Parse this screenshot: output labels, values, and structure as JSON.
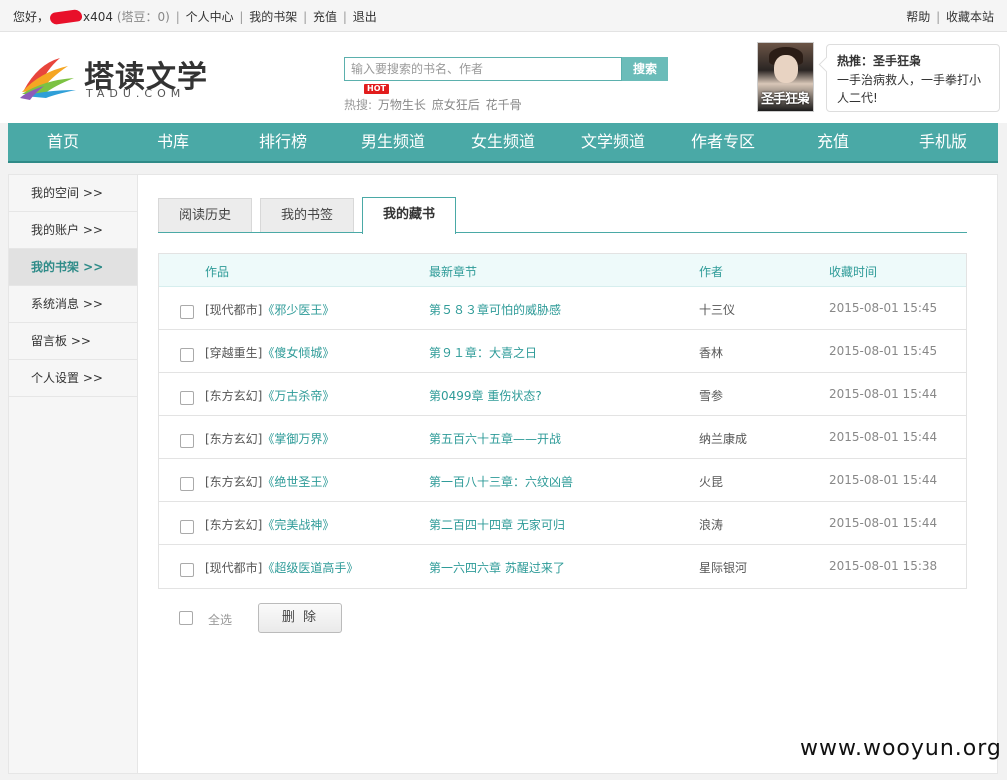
{
  "topbar": {
    "greeting_prefix": "您好，",
    "username_suffix": "x404",
    "beans": "(塔豆：0)",
    "sep": "|",
    "links": [
      "个人中心",
      "我的书架",
      "充值",
      "退出"
    ],
    "right_links": [
      "帮助",
      "收藏本站"
    ]
  },
  "header": {
    "logo_name": "塔读文学",
    "logo_sub": "TADU.COM",
    "search_placeholder": "输入要搜索的书名、作者",
    "search_button": "搜索",
    "hot_label": "热搜:",
    "hot_badge": "HOT",
    "hot_keywords": [
      "万物生长",
      "庶女狂后",
      "花千骨"
    ],
    "recommend": {
      "cover_title": "圣手狂枭",
      "title": "热推：圣手狂枭",
      "desc": "一手治病救人，一手拳打小人二代!"
    }
  },
  "nav": [
    "首页",
    "书库",
    "排行榜",
    "男生频道",
    "女生频道",
    "文学频道",
    "作者专区",
    "充值",
    "手机版"
  ],
  "sidebar": [
    {
      "label": "我的空间 >>",
      "active": false
    },
    {
      "label": "我的账户 >>",
      "active": false
    },
    {
      "label": "我的书架 >>",
      "active": true
    },
    {
      "label": "系统消息 >>",
      "active": false
    },
    {
      "label": "留言板 >>",
      "active": false
    },
    {
      "label": "个人设置 >>",
      "active": false
    }
  ],
  "tabs": [
    "阅读历史",
    "我的书签",
    "我的藏书"
  ],
  "table": {
    "headers": [
      "作品",
      "最新章节",
      "作者",
      "收藏时间"
    ],
    "rows": [
      {
        "category": "[现代都市]",
        "book": "《邪少医王》",
        "chapter": "第５８３章可怕的威胁感",
        "author": "十三仪",
        "time": "2015-08-01 15:45"
      },
      {
        "category": "[穿越重生]",
        "book": "《傻女倾城》",
        "chapter": "第９１章：大喜之日",
        "author": "香林",
        "time": "2015-08-01 15:45"
      },
      {
        "category": "[东方玄幻]",
        "book": "《万古杀帝》",
        "chapter": "第0499章 重伤状态?",
        "author": "雪参",
        "time": "2015-08-01 15:44"
      },
      {
        "category": "[东方玄幻]",
        "book": "《掌御万界》",
        "chapter": "第五百六十五章——开战",
        "author": "纳兰康成",
        "time": "2015-08-01 15:44"
      },
      {
        "category": "[东方玄幻]",
        "book": "《绝世圣王》",
        "chapter": "第一百八十三章：六纹凶兽",
        "author": "火昆",
        "time": "2015-08-01 15:44"
      },
      {
        "category": "[东方玄幻]",
        "book": "《完美战神》",
        "chapter": "第二百四十四章 无家可归",
        "author": "浪涛",
        "time": "2015-08-01 15:44"
      },
      {
        "category": "[现代都市]",
        "book": "《超级医道高手》",
        "chapter": "第一六四六章 苏醒过来了",
        "author": "星际银河",
        "time": "2015-08-01 15:38"
      }
    ]
  },
  "footer": {
    "select_all": "全选",
    "delete": "删 除"
  },
  "watermark": "www.wooyun.org",
  "colors": {
    "teal": "#4aa9a6",
    "link": "#2e9b98",
    "hot_badge": "#e21d1d"
  }
}
